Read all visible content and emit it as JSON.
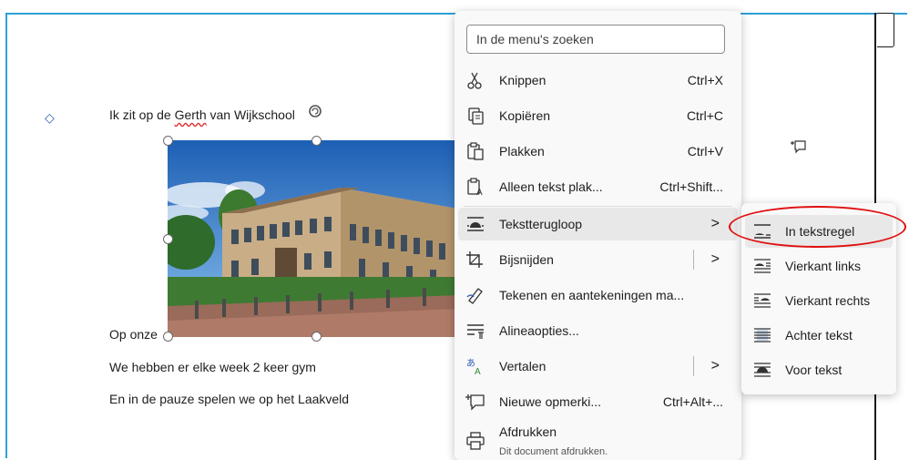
{
  "document": {
    "lines": [
      {
        "before": "Ik zit op de ",
        "underlined": "Gerth",
        "after": " van Wijkschool"
      },
      "Op onze",
      "We hebben er elke week 2 keer gym",
      "En in de pauze spelen we op het Laakveld"
    ]
  },
  "context_menu": {
    "search_placeholder": "In de menu's zoeken",
    "items": [
      {
        "label": "Knippen",
        "shortcut": "Ctrl+X",
        "icon": "scissors-icon"
      },
      {
        "label": "Kopiëren",
        "shortcut": "Ctrl+C",
        "icon": "copy-icon"
      },
      {
        "label": "Plakken",
        "shortcut": "Ctrl+V",
        "icon": "paste-icon"
      },
      {
        "label": "Alleen tekst plak...",
        "shortcut": "Ctrl+Shift...",
        "icon": "paste-text-only-icon"
      },
      {
        "label": "Tekstterugloop",
        "icon": "wrap-text-icon",
        "submenu": true
      },
      {
        "label": "Bijsnijden",
        "icon": "crop-icon",
        "submenu": true
      },
      {
        "label": "Tekenen en aantekeningen ma...",
        "icon": "draw-icon"
      },
      {
        "label": "Alineaopties...",
        "icon": "paragraph-icon"
      },
      {
        "label": "Vertalen",
        "icon": "translate-icon",
        "submenu": true
      },
      {
        "label": "Nieuwe opmerki...",
        "shortcut": "Ctrl+Alt+...",
        "icon": "new-comment-icon"
      },
      {
        "label": "Afdrukken",
        "sublabel": "Dit document afdrukken.",
        "icon": "print-icon"
      }
    ]
  },
  "wrap_submenu": {
    "items": [
      {
        "label": "In tekstregel",
        "icon": "inline-wrap-icon",
        "highlighted": true
      },
      {
        "label": "Vierkant links",
        "icon": "square-left-icon"
      },
      {
        "label": "Vierkant rechts",
        "icon": "square-right-icon"
      },
      {
        "label": "Achter tekst",
        "icon": "behind-text-icon"
      },
      {
        "label": "Voor tekst",
        "icon": "in-front-text-icon"
      }
    ]
  },
  "colors": {
    "page_border": "#2ea0d6",
    "highlight_ring": "#e01010",
    "anchor": "#2a5db0"
  }
}
